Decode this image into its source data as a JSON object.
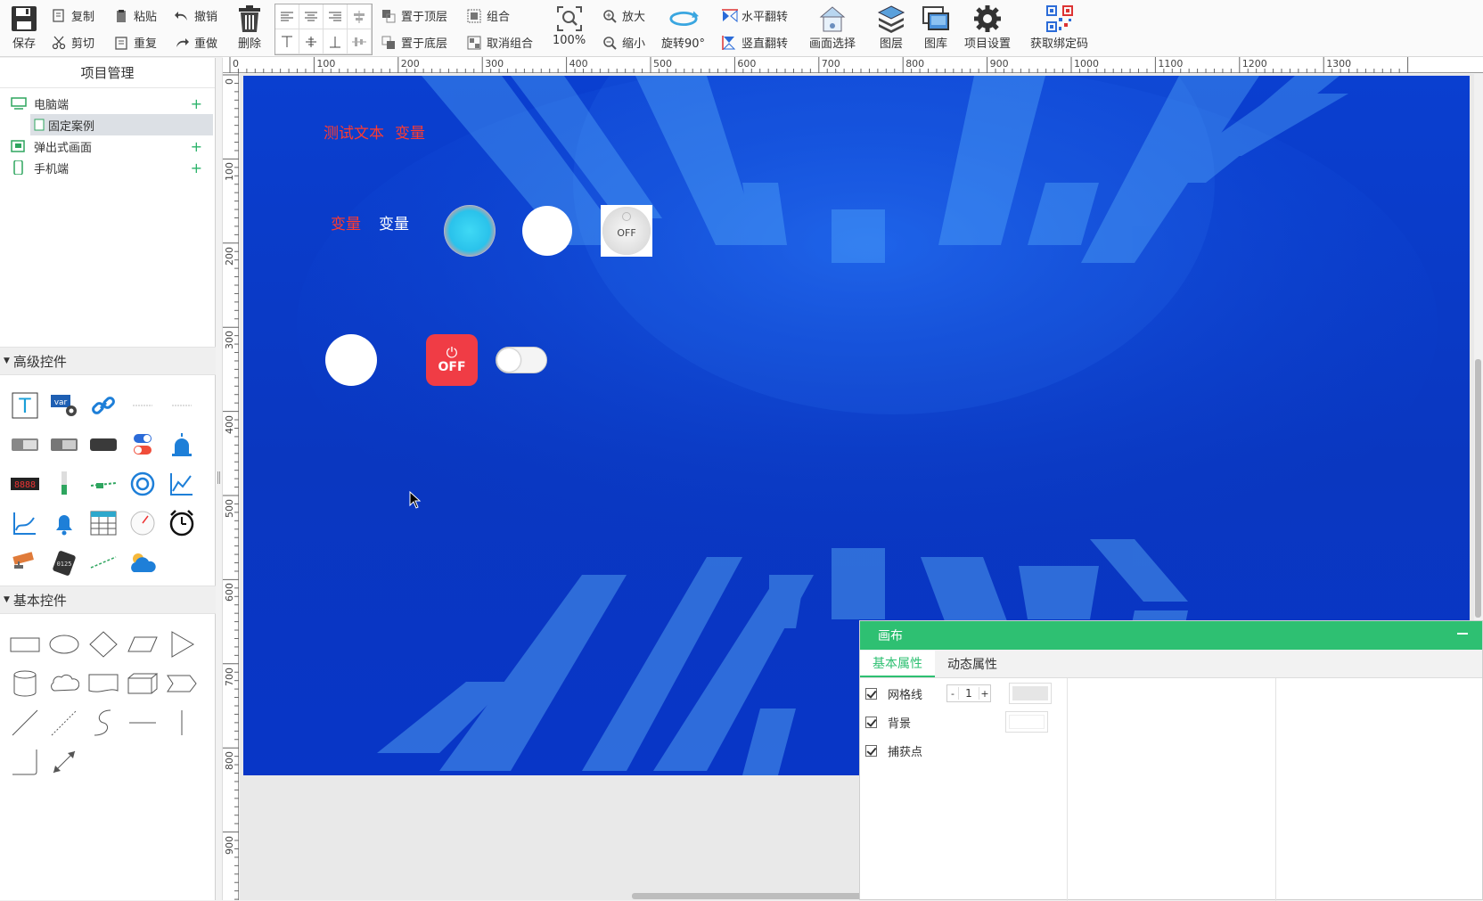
{
  "toolbar": {
    "save": "保存",
    "copy": "复制",
    "paste": "粘贴",
    "undo": "撤销",
    "cut": "剪切",
    "repeat": "重复",
    "redo": "重做",
    "delete": "删除",
    "bring_top": "置于顶层",
    "group": "组合",
    "send_bottom": "置于底层",
    "ungroup": "取消组合",
    "zoom_pct": "100%",
    "zoom_in": "放大",
    "zoom_out": "缩小",
    "rotate": "旋转90°",
    "flip_h": "水平翻转",
    "flip_v": "竖直翻转",
    "screen_select": "画面选择",
    "layers": "图层",
    "gallery": "图库",
    "project_settings": "项目设置",
    "get_bind_code": "获取绑定码"
  },
  "project": {
    "title": "项目管理",
    "items": [
      {
        "label": "电脑端",
        "plus": "+"
      },
      {
        "label": "固定案例"
      },
      {
        "label": "弹出式画面",
        "plus": "+"
      },
      {
        "label": "手机端",
        "plus": "+"
      }
    ]
  },
  "sections": {
    "advanced": "高级控件",
    "basic": "基本控件"
  },
  "ruler": {
    "h": [
      "0",
      "100",
      "200",
      "300",
      "400",
      "500",
      "600",
      "700",
      "800",
      "900",
      "1000",
      "1100",
      "1200",
      "1300"
    ],
    "v": [
      "0",
      "100",
      "200",
      "300",
      "400",
      "500",
      "600",
      "700",
      "800",
      "900"
    ]
  },
  "canvas": {
    "text1": "测试文本",
    "var1": "变量",
    "var2": "变量",
    "var3": "变量",
    "off_label": "OFF",
    "off_label2": "OFF"
  },
  "props": {
    "title": "画布",
    "tab_basic": "基本属性",
    "tab_dynamic": "动态属性",
    "gridline": "网格线",
    "gridline_value": "1",
    "minus": "-",
    "plus": "+",
    "background": "背景",
    "snap": "捕获点"
  },
  "colors": {
    "accent": "#2ec072",
    "canvas_bg": "#0a3fd0",
    "red_text": "#ff3b30"
  }
}
